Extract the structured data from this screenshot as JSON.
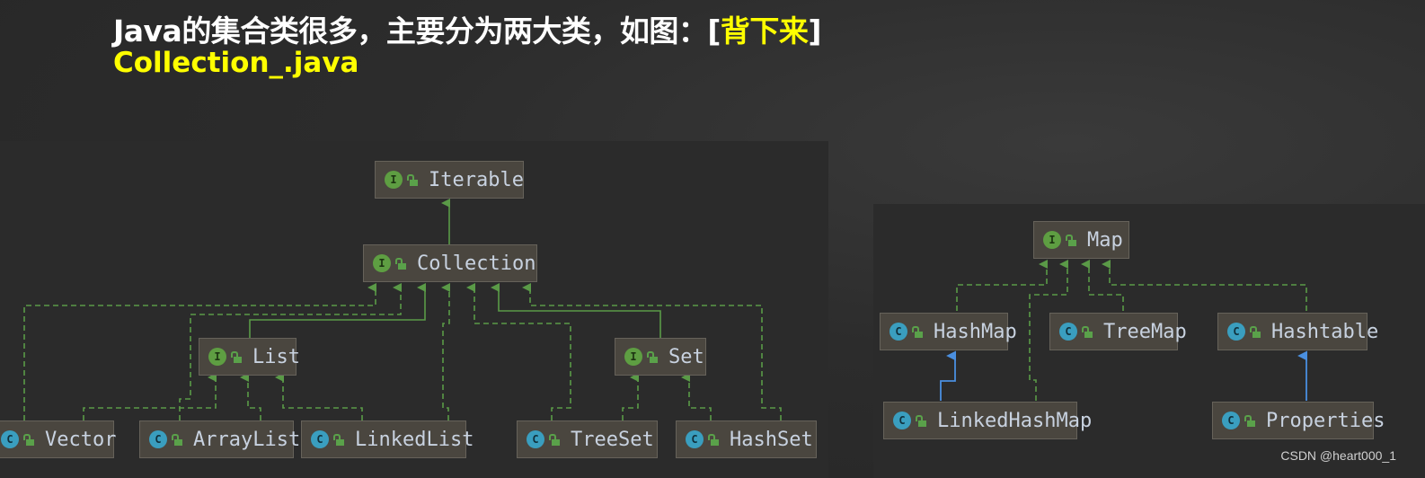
{
  "header": {
    "title_main": "Java的集合类很多，主要分为两大类，如图：[",
    "title_highlight": "背下来",
    "title_end": "]",
    "subtitle": "Collection_.java"
  },
  "colors": {
    "inherit_edge": "#5a9a47",
    "class_extends_edge": "#4a8fe0",
    "interface_badge": "#5e9e42",
    "class_badge": "#3a9ebf",
    "title_highlight": "#ffff00"
  },
  "diagrams": {
    "collection": {
      "nodes": [
        {
          "id": "iterable",
          "label": "Iterable",
          "kind": "interface",
          "badge": "I"
        },
        {
          "id": "collection",
          "label": "Collection",
          "kind": "interface",
          "badge": "I"
        },
        {
          "id": "list",
          "label": "List",
          "kind": "interface",
          "badge": "I"
        },
        {
          "id": "set",
          "label": "Set",
          "kind": "interface",
          "badge": "I"
        },
        {
          "id": "vector",
          "label": "Vector",
          "kind": "class",
          "badge": "C"
        },
        {
          "id": "arraylist",
          "label": "ArrayList",
          "kind": "class",
          "badge": "C"
        },
        {
          "id": "linkedlist",
          "label": "LinkedList",
          "kind": "class",
          "badge": "C"
        },
        {
          "id": "treeset",
          "label": "TreeSet",
          "kind": "class",
          "badge": "C"
        },
        {
          "id": "hashset",
          "label": "HashSet",
          "kind": "class",
          "badge": "C"
        }
      ]
    },
    "map": {
      "nodes": [
        {
          "id": "map",
          "label": "Map",
          "kind": "interface",
          "badge": "I"
        },
        {
          "id": "hashmap",
          "label": "HashMap",
          "kind": "class",
          "badge": "C"
        },
        {
          "id": "treemap",
          "label": "TreeMap",
          "kind": "class",
          "badge": "C"
        },
        {
          "id": "hashtable",
          "label": "Hashtable",
          "kind": "class",
          "badge": "C"
        },
        {
          "id": "linkedhashmap",
          "label": "LinkedHashMap",
          "kind": "class",
          "badge": "C"
        },
        {
          "id": "properties",
          "label": "Properties",
          "kind": "class",
          "badge": "C"
        }
      ]
    }
  },
  "watermark": "CSDN @heart000_1"
}
